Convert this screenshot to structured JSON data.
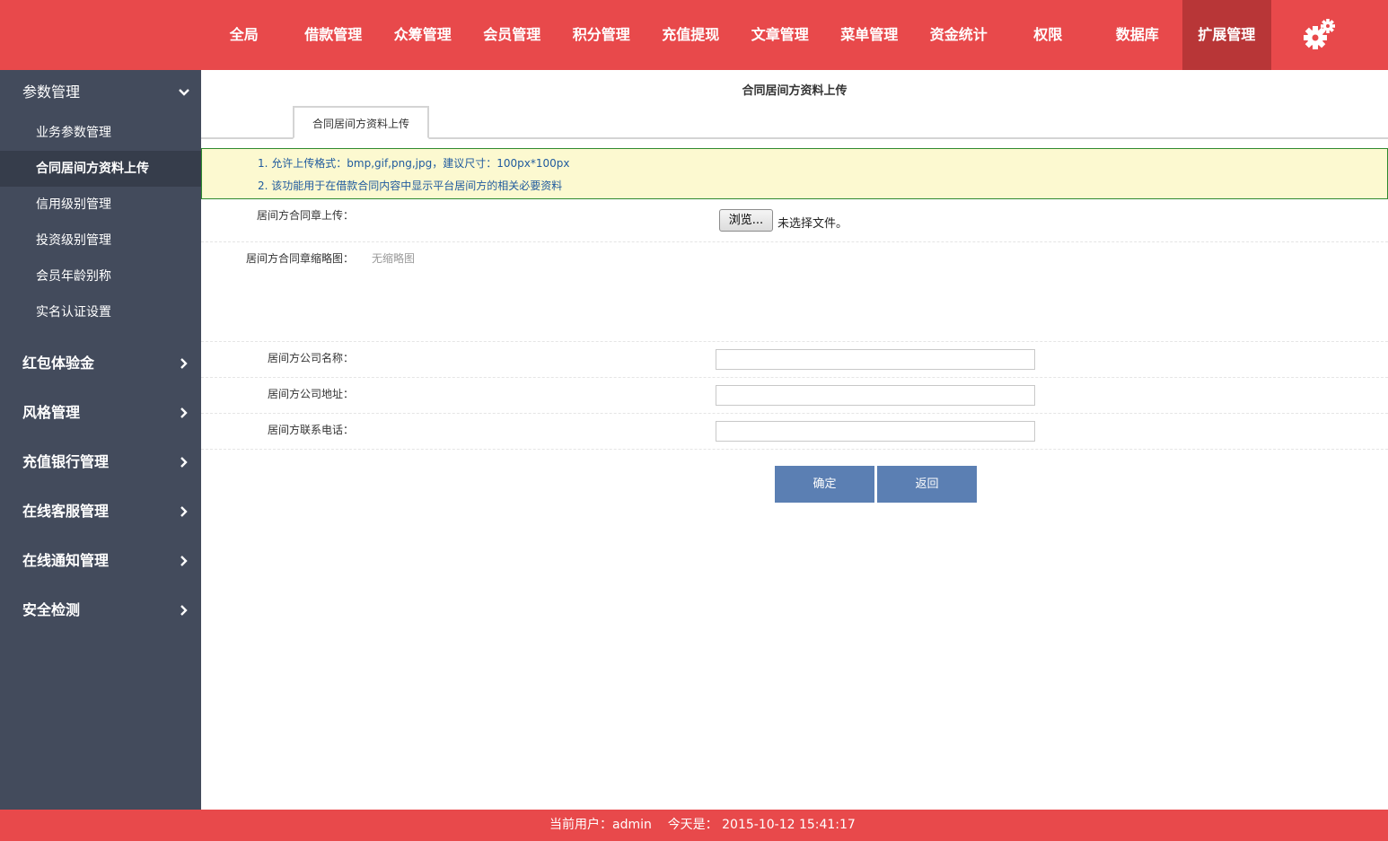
{
  "topnav": {
    "items": [
      "全局",
      "借款管理",
      "众筹管理",
      "会员管理",
      "积分管理",
      "充值提现",
      "文章管理",
      "菜单管理",
      "资金统计",
      "权限",
      "数据库",
      "扩展管理"
    ],
    "active_index": 11,
    "settings_icon": "gears-icon"
  },
  "sidebar": {
    "groups": [
      {
        "label": "参数管理",
        "expanded": true,
        "items": [
          "业务参数管理",
          "合同居间方资料上传",
          "信用级别管理",
          "投资级别管理",
          "会员年龄别称",
          "实名认证设置"
        ],
        "active_item": 1
      },
      {
        "label": "红包体验金",
        "expanded": false
      },
      {
        "label": "风格管理",
        "expanded": false
      },
      {
        "label": "充值银行管理",
        "expanded": false
      },
      {
        "label": "在线客服管理",
        "expanded": false
      },
      {
        "label": "在线通知管理",
        "expanded": false
      },
      {
        "label": "安全检测",
        "expanded": false
      }
    ]
  },
  "main": {
    "title": "合同居间方资料上传",
    "tab_label": "合同居间方资料上传",
    "notice": [
      "1. 允许上传格式：bmp,gif,png,jpg，建议尺寸：100px*100px",
      "2. 该功能用于在借款合同内容中显示平台居间方的相关必要资料"
    ],
    "form": {
      "seal_upload_label": "居间方合同章上传：",
      "browse_label": "浏览...",
      "file_status": "未选择文件。",
      "thumb_label": "居间方合同章缩略图：",
      "thumb_empty": "无缩略图",
      "company_name_label": "居间方公司名称：",
      "company_name_value": "",
      "company_address_label": "居间方公司地址：",
      "company_address_value": "",
      "phone_label": "居间方联系电话：",
      "phone_value": ""
    },
    "confirm_label": "确定",
    "back_label": "返回"
  },
  "footer": {
    "user_prefix": "当前用户：",
    "user": "admin",
    "date_prefix": "今天是：",
    "datetime": "2015-10-12 15:41:17"
  },
  "colors": {
    "brand_red": "#e8494b",
    "nav_active": "#b83637",
    "sidebar_bg": "#434b5c",
    "button_blue": "#5b7fb3"
  }
}
